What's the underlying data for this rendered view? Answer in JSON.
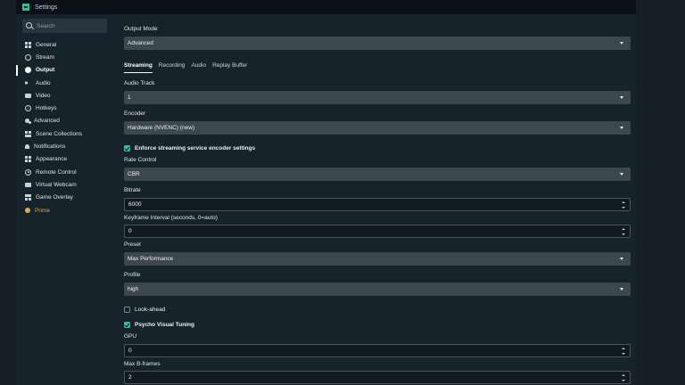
{
  "window": {
    "title": "Settings"
  },
  "colors": {
    "accent": "#1fc7a0",
    "prime": "#e3a93c"
  },
  "sidebar": {
    "search_placeholder": "Search",
    "items": [
      {
        "label": "General",
        "icon": "grid-icon"
      },
      {
        "label": "Stream",
        "icon": "globe-icon"
      },
      {
        "label": "Output",
        "icon": "output-icon",
        "active": true
      },
      {
        "label": "Audio",
        "icon": "speaker-icon"
      },
      {
        "label": "Video",
        "icon": "video-icon"
      },
      {
        "label": "Hotkeys",
        "icon": "gear-icon"
      },
      {
        "label": "Advanced",
        "icon": "gears-icon"
      },
      {
        "label": "Scene Collections",
        "icon": "scene-icon"
      },
      {
        "label": "Notifications",
        "icon": "bell-icon"
      },
      {
        "label": "Appearance",
        "icon": "appearance-icon"
      },
      {
        "label": "Remote Control",
        "icon": "remote-icon"
      },
      {
        "label": "Virtual Webcam",
        "icon": "camera-icon"
      },
      {
        "label": "Game Overlay",
        "icon": "overlay-icon"
      },
      {
        "label": "Prime",
        "icon": "prime-icon"
      }
    ]
  },
  "main": {
    "output_mode": {
      "label": "Output Mode",
      "value": "Advanced"
    },
    "tabs": [
      "Streaming",
      "Recording",
      "Audio",
      "Replay Buffer"
    ],
    "audio_track": {
      "label": "Audio Track",
      "value": "1"
    },
    "encoder": {
      "label": "Encoder",
      "value": "Hardware (NVENC) (new)"
    },
    "enforce": {
      "label": "Enforce streaming service encoder settings",
      "checked": true
    },
    "rate_control": {
      "label": "Rate Control",
      "value": "CBR"
    },
    "bitrate": {
      "label": "Bitrate",
      "value": "6000"
    },
    "keyframe": {
      "label": "Keyframe Interval (seconds, 0=auto)",
      "value": "0"
    },
    "preset": {
      "label": "Preset",
      "value": "Max Performance"
    },
    "profile": {
      "label": "Profile",
      "value": "high"
    },
    "lookahead": {
      "label": "Look-ahead",
      "checked": false
    },
    "psycho": {
      "label": "Psycho Visual Tuning",
      "checked": true
    },
    "gpu": {
      "label": "GPU",
      "value": "0"
    },
    "bframes": {
      "label": "Max B-frames",
      "value": "2"
    }
  }
}
